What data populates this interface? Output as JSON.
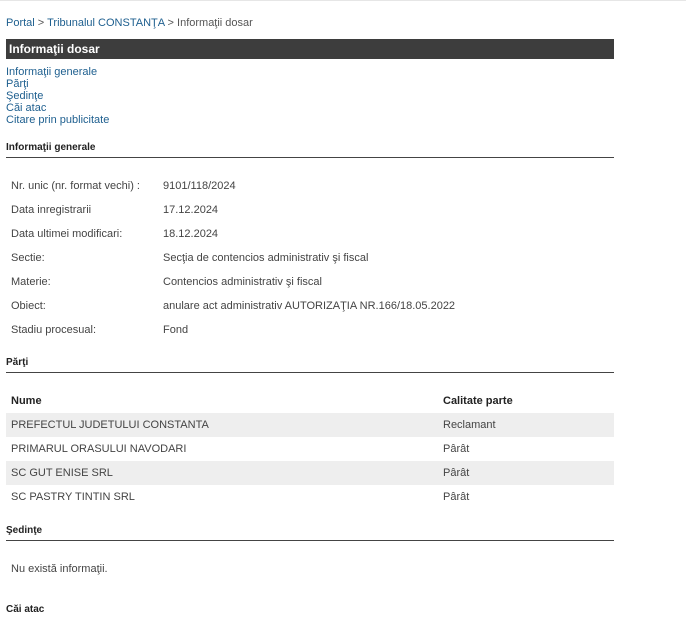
{
  "breadcrumb": {
    "portal": "Portal",
    "sep1": " > ",
    "court": "Tribunalul CONSTANŢA",
    "sep2": " > ",
    "current": "Informaţii dosar"
  },
  "header": {
    "title": "Informaţii dosar"
  },
  "toc": [
    "Informaţii generale",
    "Părţi",
    "Şedinţe",
    "Căi atac",
    "Citare prin publicitate"
  ],
  "general": {
    "title": "Informaţii generale",
    "rows": [
      {
        "label": "Nr. unic (nr. format vechi) :",
        "value": "9101/118/2024"
      },
      {
        "label": "Data inregistrarii",
        "value": "17.12.2024"
      },
      {
        "label": "Data ultimei modificari:",
        "value": "18.12.2024"
      },
      {
        "label": "Sectie:",
        "value": "Secţia de contencios administrativ şi fiscal"
      },
      {
        "label": "Materie:",
        "value": "Contencios administrativ şi fiscal"
      },
      {
        "label": "Obiect:",
        "value": "anulare act administrativ AUTORIZAŢIA NR.166/18.05.2022"
      },
      {
        "label": "Stadiu procesual:",
        "value": "Fond"
      }
    ]
  },
  "parti": {
    "title": "Părţi",
    "headers": {
      "name": "Nume",
      "quality": "Calitate parte"
    },
    "rows": [
      {
        "name": "PREFECTUL JUDETULUI CONSTANTA",
        "quality": "Reclamant"
      },
      {
        "name": "PRIMARUL ORASULUI NAVODARI",
        "quality": "Pârât"
      },
      {
        "name": "SC GUT ENISE SRL",
        "quality": "Pârât"
      },
      {
        "name": "SC PASTRY TINTIN SRL",
        "quality": "Pârât"
      }
    ]
  },
  "sedinte": {
    "title": "Şedinţe",
    "empty": "Nu există informaţii."
  },
  "cai_atac": {
    "title": "Căi atac"
  }
}
